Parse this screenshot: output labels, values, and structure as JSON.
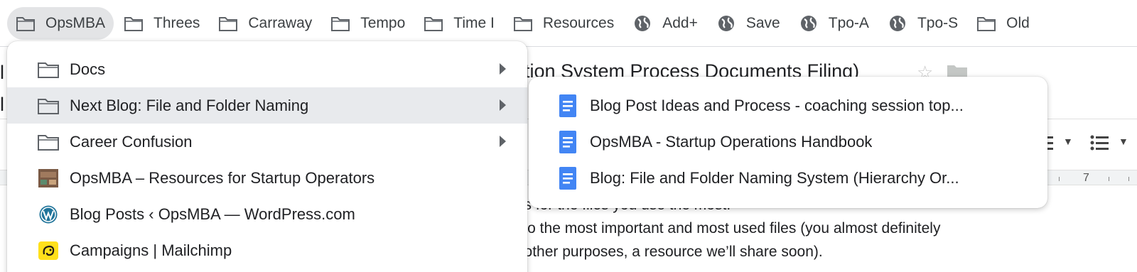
{
  "bookmarks_bar": {
    "items": [
      {
        "label": "OpsMBA",
        "icon": "folder-icon"
      },
      {
        "label": "Threes",
        "icon": "folder-icon"
      },
      {
        "label": "Carraway",
        "icon": "folder-icon"
      },
      {
        "label": "Tempo",
        "icon": "folder-icon"
      },
      {
        "label": "Time I",
        "icon": "folder-icon"
      },
      {
        "label": "Resources",
        "icon": "folder-icon"
      },
      {
        "label": "Add+",
        "icon": "globe-icon"
      },
      {
        "label": "Save",
        "icon": "globe-icon"
      },
      {
        "label": "Tpo-A",
        "icon": "globe-icon"
      },
      {
        "label": "Tpo-S",
        "icon": "globe-icon"
      },
      {
        "label": "Old",
        "icon": "folder-icon"
      }
    ]
  },
  "menu": {
    "items": [
      {
        "label": "Docs",
        "icon": "folder-icon",
        "has_submenu": true
      },
      {
        "label": "Next Blog: File and Folder Naming",
        "icon": "folder-icon",
        "has_submenu": true
      },
      {
        "label": "Career Confusion",
        "icon": "folder-icon",
        "has_submenu": true
      },
      {
        "label": "OpsMBA – Resources for Startup Operators",
        "icon": "opsmba-favicon"
      },
      {
        "label": "Blog Posts ‹ OpsMBA — WordPress.com",
        "icon": "wordpress-icon"
      },
      {
        "label": "Campaigns | Mailchimp",
        "icon": "mailchimp-icon"
      }
    ]
  },
  "submenu": {
    "items": [
      {
        "label": "Blog Post Ideas and Process - coaching session top...",
        "icon": "google-docs-icon"
      },
      {
        "label": "OpsMBA - Startup Operations Handbook",
        "icon": "google-docs-icon"
      },
      {
        "label": "Blog: File and Folder Naming System (Hierarchy Or...",
        "icon": "google-docs-icon"
      }
    ]
  },
  "background_doc": {
    "title_fragment": "tion System Process Documents Filing)",
    "edge_text_1": "l",
    "edge_text_2": "l",
    "ruler_number": "7",
    "body_lines": [
      "nts for the files you use the most.",
      "s to the most important and most used files (you almost definitely",
      "d other purposes, a resource we’ll share soon)."
    ]
  },
  "colors": {
    "folder_stroke": "#5f6368",
    "docs_blue": "#4285f4",
    "wordpress_blue": "#21759b",
    "mailchimp_yellow": "#ffe01b",
    "hover_gray": "#e8eaed"
  }
}
